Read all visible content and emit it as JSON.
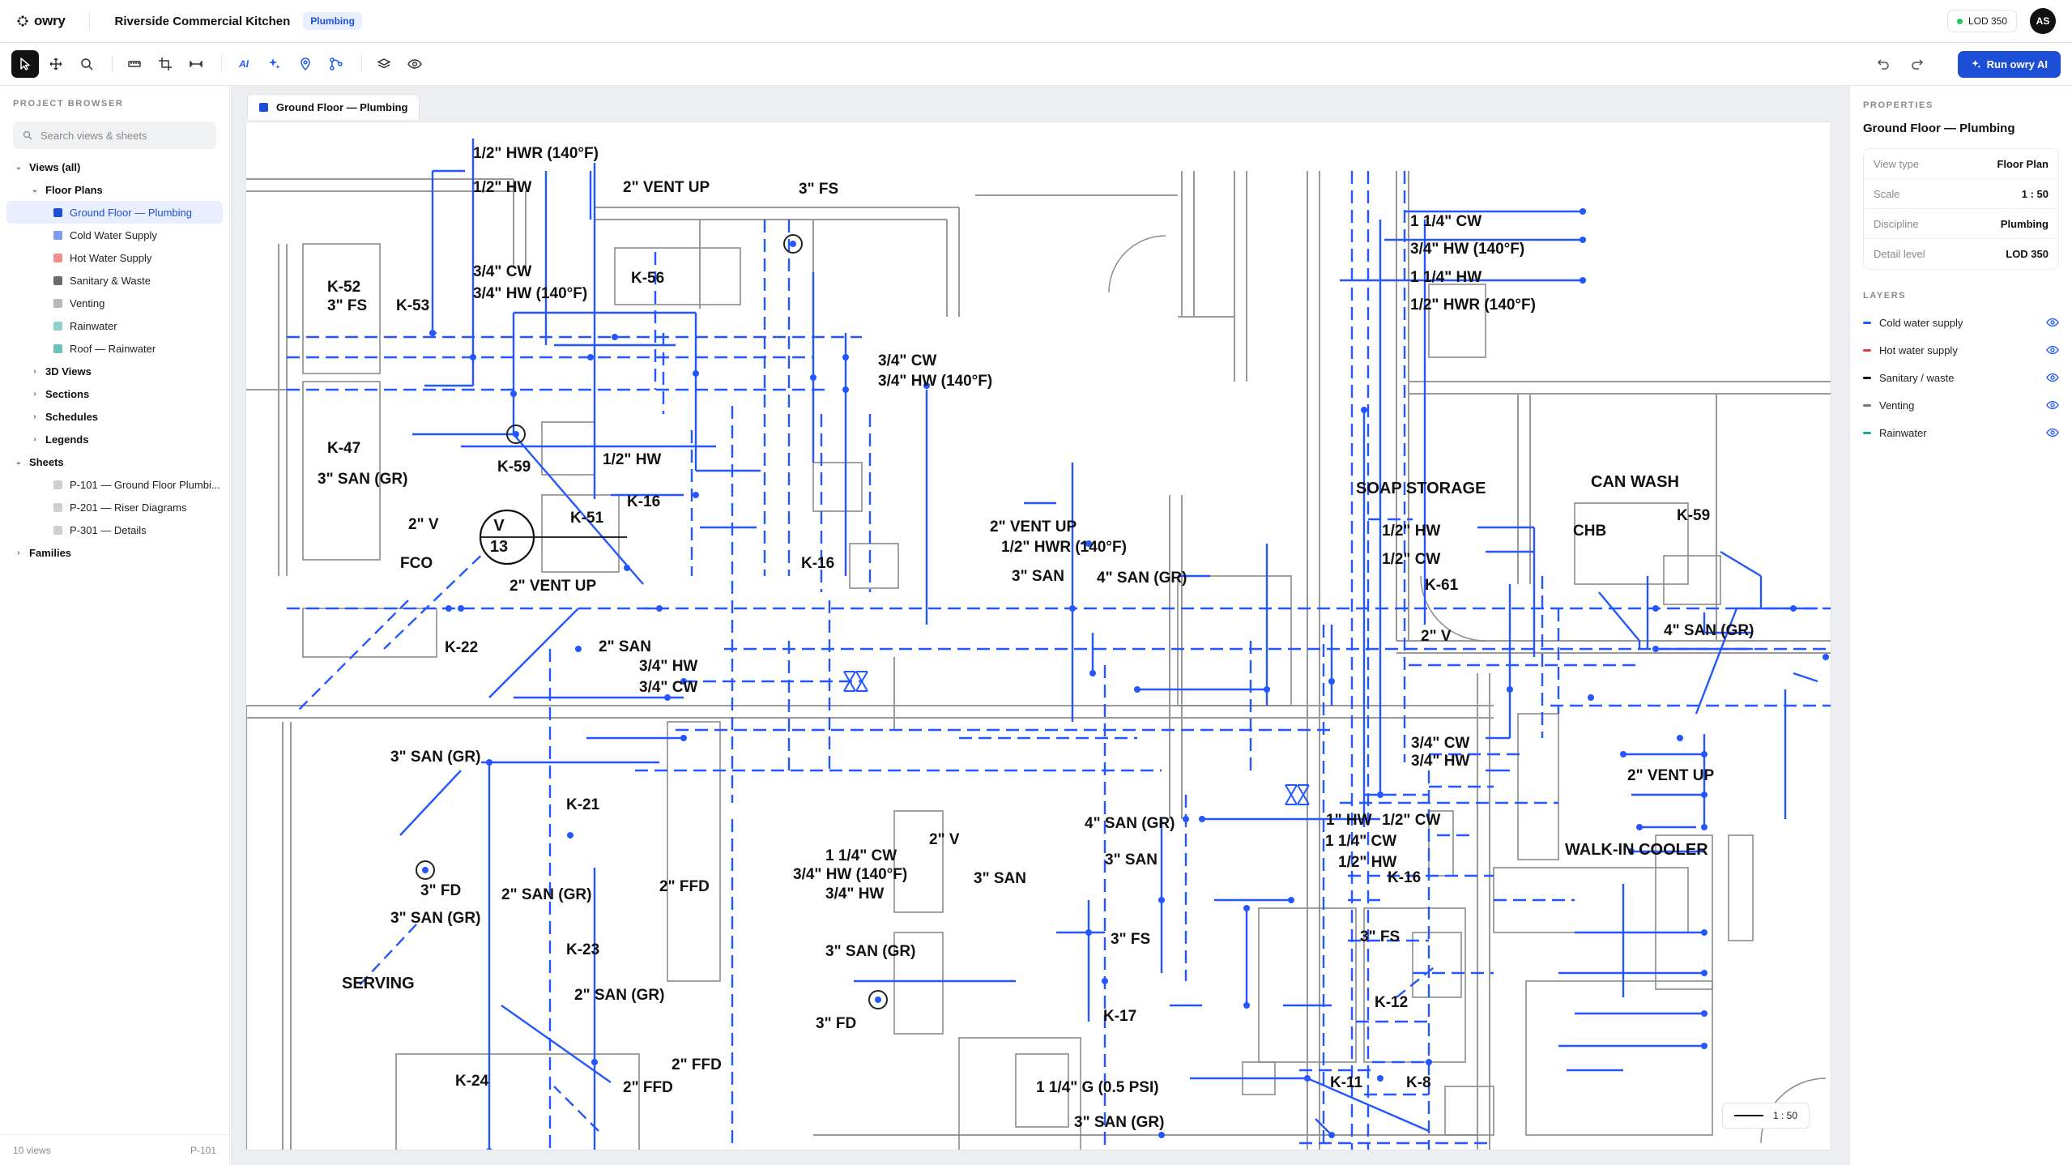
{
  "app": {
    "name": "owry"
  },
  "project": {
    "title": "Riverside Commercial Kitchen",
    "discipline_badge": "Plumbing"
  },
  "topbar": {
    "lod_label": "LOD 350",
    "avatar_initials": "AS"
  },
  "toolbar": {
    "ai_label": "AI",
    "run_label": "Run owry AI",
    "tools": [
      "select-icon",
      "move-icon",
      "zoom-icon",
      "measure-icon",
      "crop-icon",
      "dimension-icon",
      "ai-label",
      "sparkle-icon",
      "pin-icon",
      "route-icon",
      "layers-icon",
      "eye-icon",
      "undo-icon",
      "redo-icon"
    ]
  },
  "sidebar": {
    "heading": "PROJECT BROWSER",
    "search_placeholder": "Search views & sheets",
    "views_all": "Views (all)",
    "floor_plans": "Floor Plans",
    "plans": [
      {
        "label": "Ground Floor — Plumbing",
        "color": "#1d4ed8"
      },
      {
        "label": "Cold Water Supply",
        "color": "#7c9cf0"
      },
      {
        "label": "Hot Water Supply",
        "color": "#f0908c"
      },
      {
        "label": "Sanitary & Waste",
        "color": "#6b6b6b"
      },
      {
        "label": "Venting",
        "color": "#b8b8b8"
      },
      {
        "label": "Rainwater",
        "color": "#8fd0cc"
      },
      {
        "label": "Roof — Rainwater",
        "color": "#6cc1bc"
      }
    ],
    "groups": [
      "3D Views",
      "Sections",
      "Schedules",
      "Legends"
    ],
    "sheets_label": "Sheets",
    "sheets": [
      "P-101 — Ground Floor Plumbi...",
      "P-201 — Riser Diagrams",
      "P-301 — Details"
    ],
    "families_label": "Families",
    "footer_left": "10 views",
    "footer_right": "P-101"
  },
  "canvas": {
    "tab_label": "Ground Floor — Plumbing",
    "scale_label": "1 : 50",
    "drawing_labels": [
      "1/2\" HWR (140°F)",
      "1/2\" HW",
      "2\" VENT UP",
      "3\" FS",
      "K-52",
      "3\" FS",
      "K-53",
      "3/4\" CW",
      "3/4\" HW (140°F)",
      "K-56",
      "3/4\" CW",
      "3/4\" HW (140°F)",
      "K-47",
      "3\" SAN (GR)",
      "K-59",
      "1/2\" HW",
      "K-16",
      "K-51",
      "2\" V",
      "V",
      "13",
      "FCO",
      "2\" VENT UP",
      "K-16",
      "2\" VENT UP",
      "1/2\" HWR (140°F)",
      "3\" SAN",
      "4\" SAN (GR)",
      "K-22",
      "2\" SAN",
      "3/4\" HW",
      "3/4\" CW",
      "3\" SAN (GR)",
      "K-21",
      "3\" FD",
      "3\" SAN (GR)",
      "2\" SAN (GR)",
      "2\" FFD",
      "K-23",
      "SERVING",
      "2\" SAN (GR)",
      "2\" FFD",
      "K-24",
      "2\" FFD",
      "1 1/4\" CW",
      "3/4\" HW (140°F)",
      "3/4\" HW",
      "2\" V",
      "4\" SAN (GR)",
      "3\" SAN",
      "3\" SAN",
      "3\" SAN (GR)",
      "3\" FD",
      "3\" FS",
      "K-17",
      "1 1/4\" G (0.5 PSI)",
      "3\" SAN (GR)",
      "1 1/4\" CW",
      "3/4\" HW (140°F)",
      "1 1/4\" HW",
      "1/2\" HWR (140°F)",
      "SOAP STORAGE",
      "CAN WASH",
      "1/2\" HW",
      "CHB",
      "1/2\" CW",
      "K-61",
      "K-59",
      "4\" SAN (GR)",
      "2\" V",
      "3/4\" CW",
      "3/4\" HW",
      "2\" VENT UP",
      "1\" HW",
      "1/2\" CW",
      "1 1/4\" CW",
      "1/2\" HW",
      "K-16",
      "WALK-IN COOLER",
      "3\" FS",
      "K-12",
      "K-11",
      "K-8"
    ]
  },
  "properties": {
    "heading": "PROPERTIES",
    "title": "Ground Floor — Plumbing",
    "rows": [
      {
        "key": "View type",
        "value": "Floor Plan"
      },
      {
        "key": "Scale",
        "value": "1 : 50"
      },
      {
        "key": "Discipline",
        "value": "Plumbing"
      },
      {
        "key": "Detail level",
        "value": "LOD 350"
      }
    ],
    "layers_heading": "LAYERS",
    "layers": [
      {
        "label": "Cold water supply",
        "color": "#2457ff"
      },
      {
        "label": "Hot water supply",
        "color": "#e23b3b"
      },
      {
        "label": "Sanitary / waste",
        "color": "#111111"
      },
      {
        "label": "Venting",
        "color": "#777777"
      },
      {
        "label": "Rainwater",
        "color": "#1fa8a0"
      }
    ]
  },
  "colors": {
    "accent": "#1d4ed8",
    "pipe_blue": "#2457ff",
    "selection_bg": "#e9effe"
  }
}
